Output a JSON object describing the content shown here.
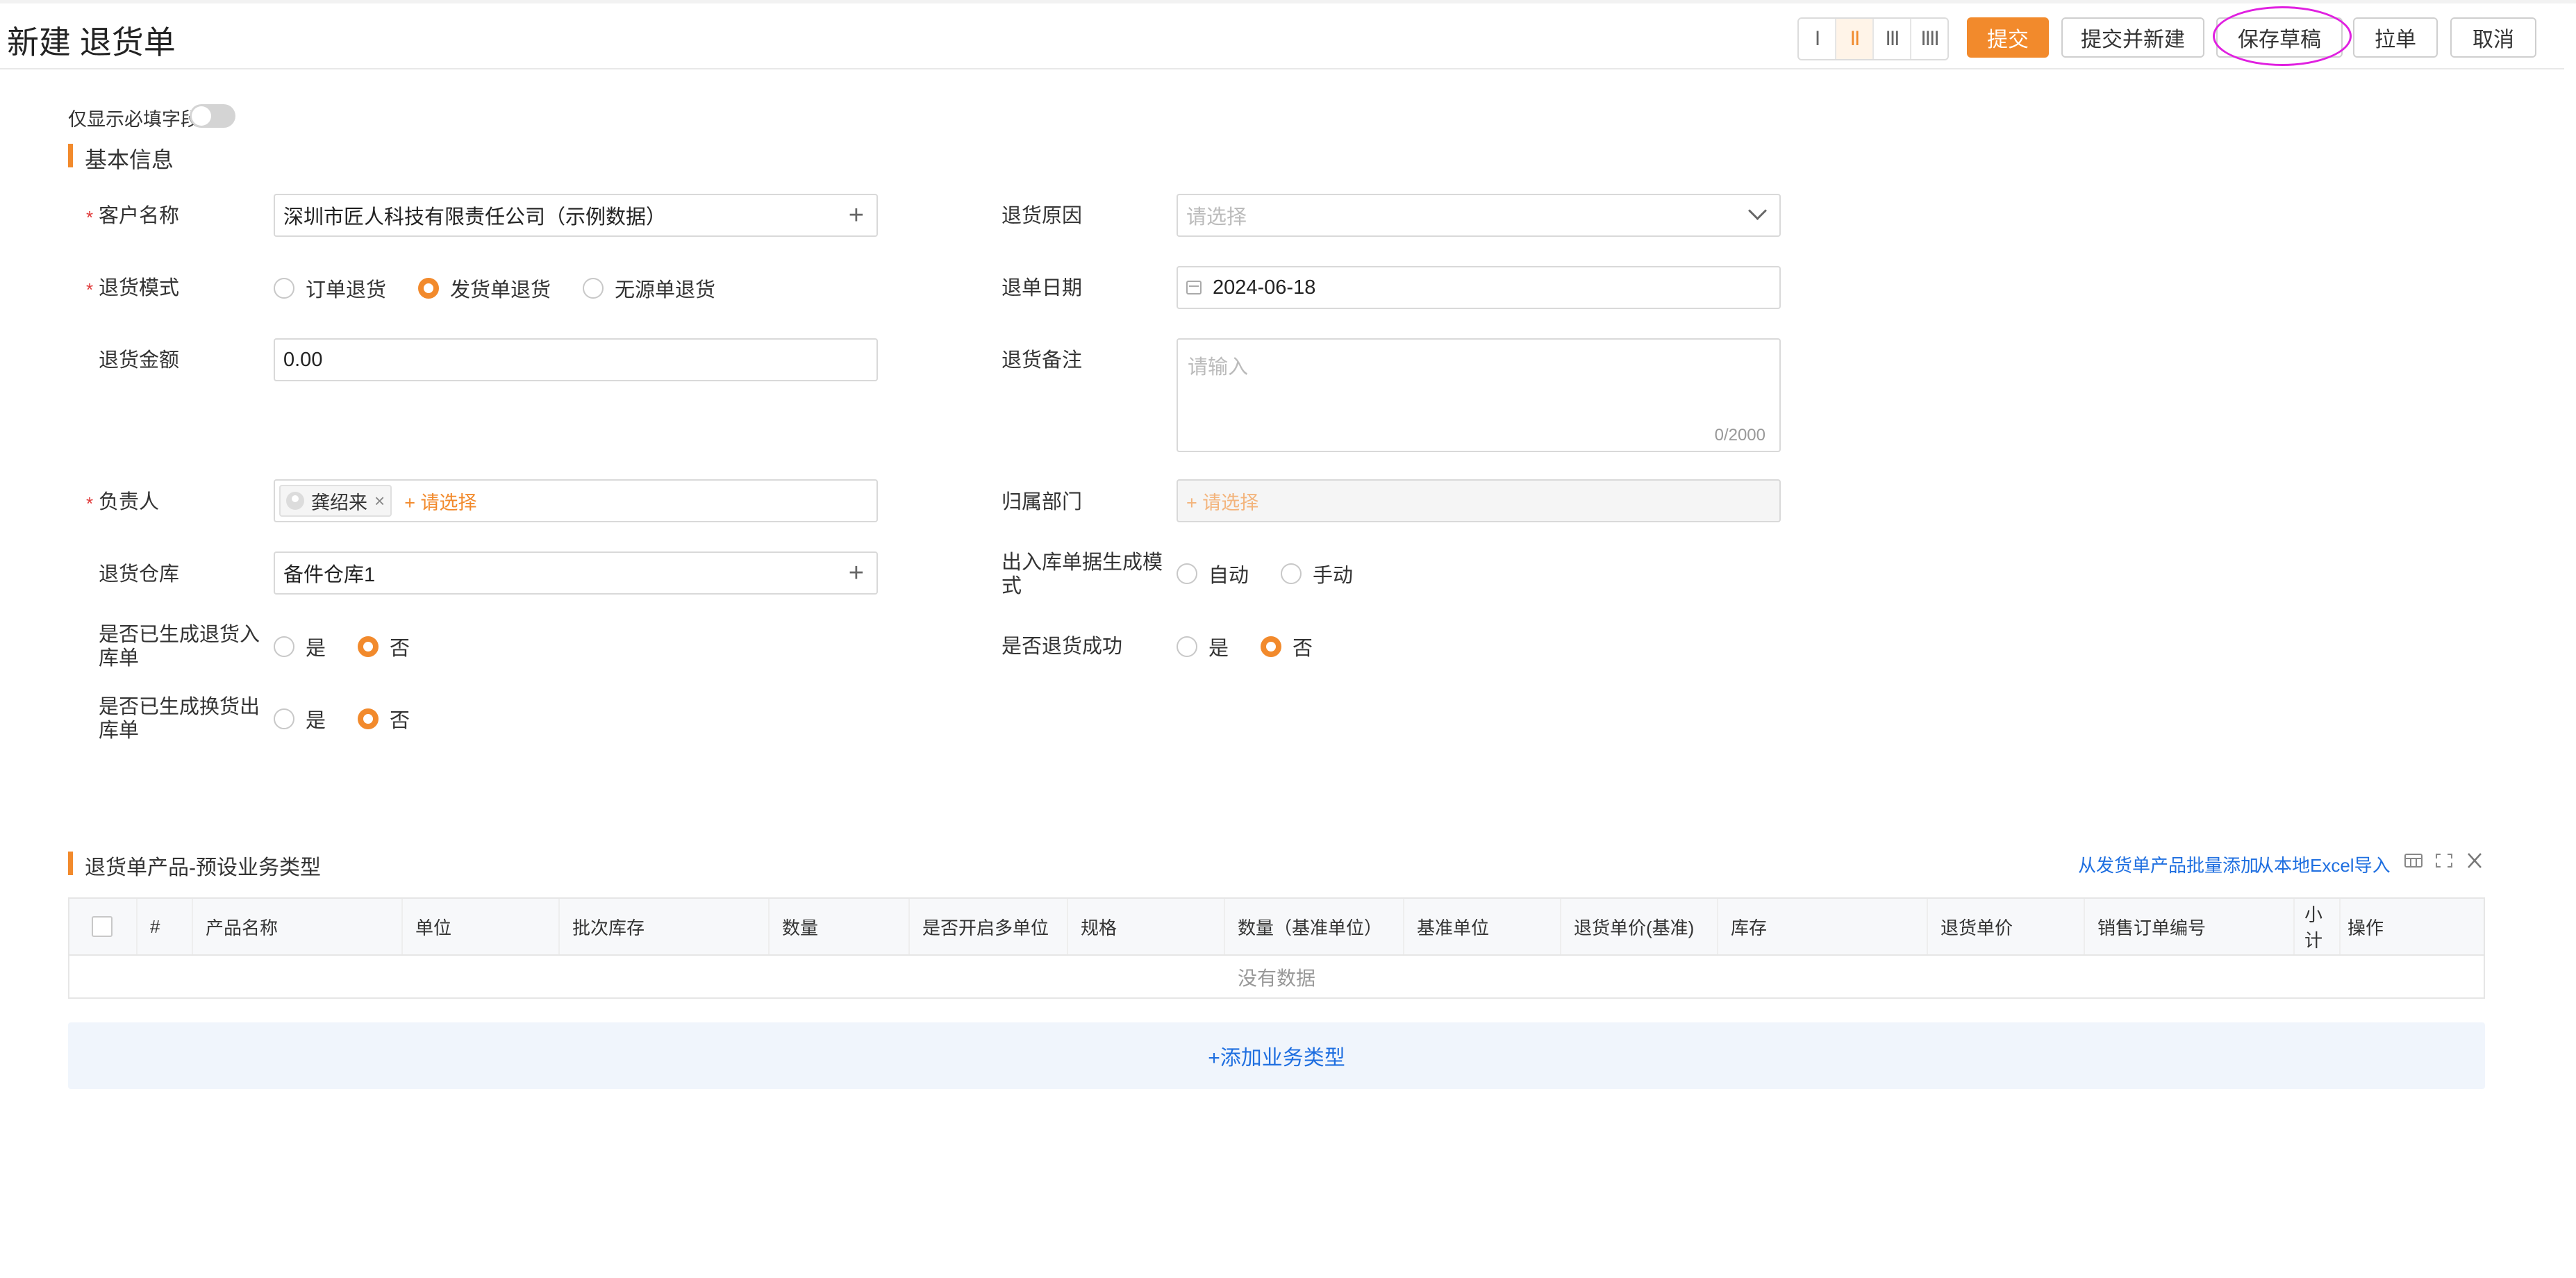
{
  "header": {
    "title": "新建 退货单",
    "layout_options": [
      "I",
      "II",
      "III",
      "IIII"
    ],
    "active_layout": "II",
    "buttons": {
      "submit": "提交",
      "submit_new": "提交并新建",
      "save_draft": "保存草稿",
      "pull": "拉单",
      "cancel": "取消"
    }
  },
  "filter": {
    "required_only_label": "仅显示必填字段"
  },
  "basic_info": {
    "title": "基本信息",
    "customer": {
      "label": "客户名称",
      "value": "深圳市匠人科技有限责任公司（示例数据）"
    },
    "return_reason": {
      "label": "退货原因",
      "placeholder": "请选择"
    },
    "return_mode": {
      "label": "退货模式",
      "options": [
        "订单退货",
        "发货单退货",
        "无源单退货"
      ],
      "selected": "发货单退货"
    },
    "return_date": {
      "label": "退单日期",
      "value": "2024-06-18"
    },
    "amount": {
      "label": "退货金额",
      "value": "0.00"
    },
    "remark": {
      "label": "退货备注",
      "placeholder": "请输入",
      "count": "0/2000"
    },
    "owner": {
      "label": "负责人",
      "tag": "龚绍来",
      "add": "+ 请选择"
    },
    "department": {
      "label": "归属部门",
      "add": "+ 请选择"
    },
    "warehouse": {
      "label": "退货仓库",
      "value": "备件仓库1"
    },
    "io_mode": {
      "label": "出入库单据生成模式",
      "options": [
        "自动",
        "手动"
      ]
    },
    "generated_in": {
      "label": "是否已生成退货入库单",
      "options": [
        "是",
        "否"
      ],
      "selected": "否"
    },
    "return_success": {
      "label": "是否退货成功",
      "options": [
        "是",
        "否"
      ],
      "selected": "否"
    },
    "generated_out": {
      "label": "是否已生成换货出库单",
      "options": [
        "是",
        "否"
      ],
      "selected": "否"
    }
  },
  "products": {
    "title": "退货单产品-预设业务类型",
    "link_batch": "从发货单产品批量添加",
    "link_excel": "从本地Excel导入",
    "columns": [
      "#",
      "产品名称",
      "单位",
      "批次库存",
      "数量",
      "是否开启多单位",
      "规格",
      "数量（基准单位）",
      "基准单位",
      "退货单价(基准)",
      "库存",
      "退货单价",
      "销售订单编号",
      "小计",
      "操作"
    ],
    "empty_text": "没有数据",
    "add_type": "+添加业务类型"
  },
  "colors": {
    "accent": "#f28a2c",
    "link": "#1f6fe0",
    "required": "#e03b3b"
  }
}
